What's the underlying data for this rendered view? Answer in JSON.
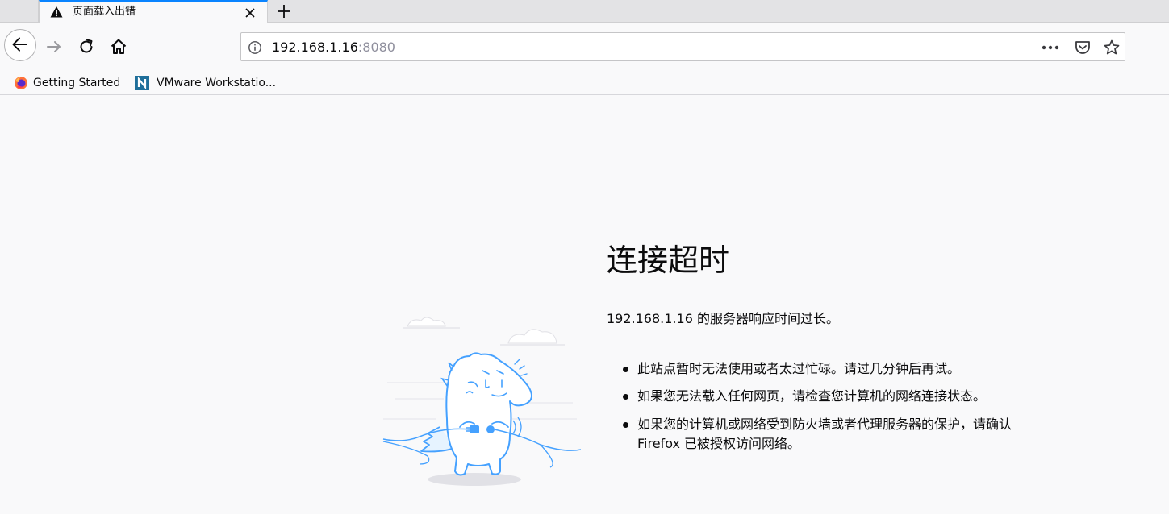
{
  "tab": {
    "title": "页面载入出错",
    "icon": "warning-icon"
  },
  "navbar": {
    "url_host": "192.168.1.16",
    "url_port": ":8080"
  },
  "bookmarks": [
    {
      "label": "Getting Started",
      "icon": "firefox-icon"
    },
    {
      "label": "VMware Workstatio...",
      "icon": "vmware-n-icon"
    }
  ],
  "error": {
    "title": "连接超时",
    "description": "192.168.1.16 的服务器响应时间过长。",
    "tips": [
      "此站点暂时无法使用或者太过忙碌。请过几分钟后再试。",
      "如果您无法载入任何网页，请检查您计算机的网络连接状态。",
      "如果您的计算机或网络受到防火墙或者代理服务器的保护，请确认 Firefox 已被授权访问网络。"
    ]
  },
  "colors": {
    "accent": "#0a84ff",
    "illustration": "#45a1ff",
    "background": "#f9f9fa"
  }
}
